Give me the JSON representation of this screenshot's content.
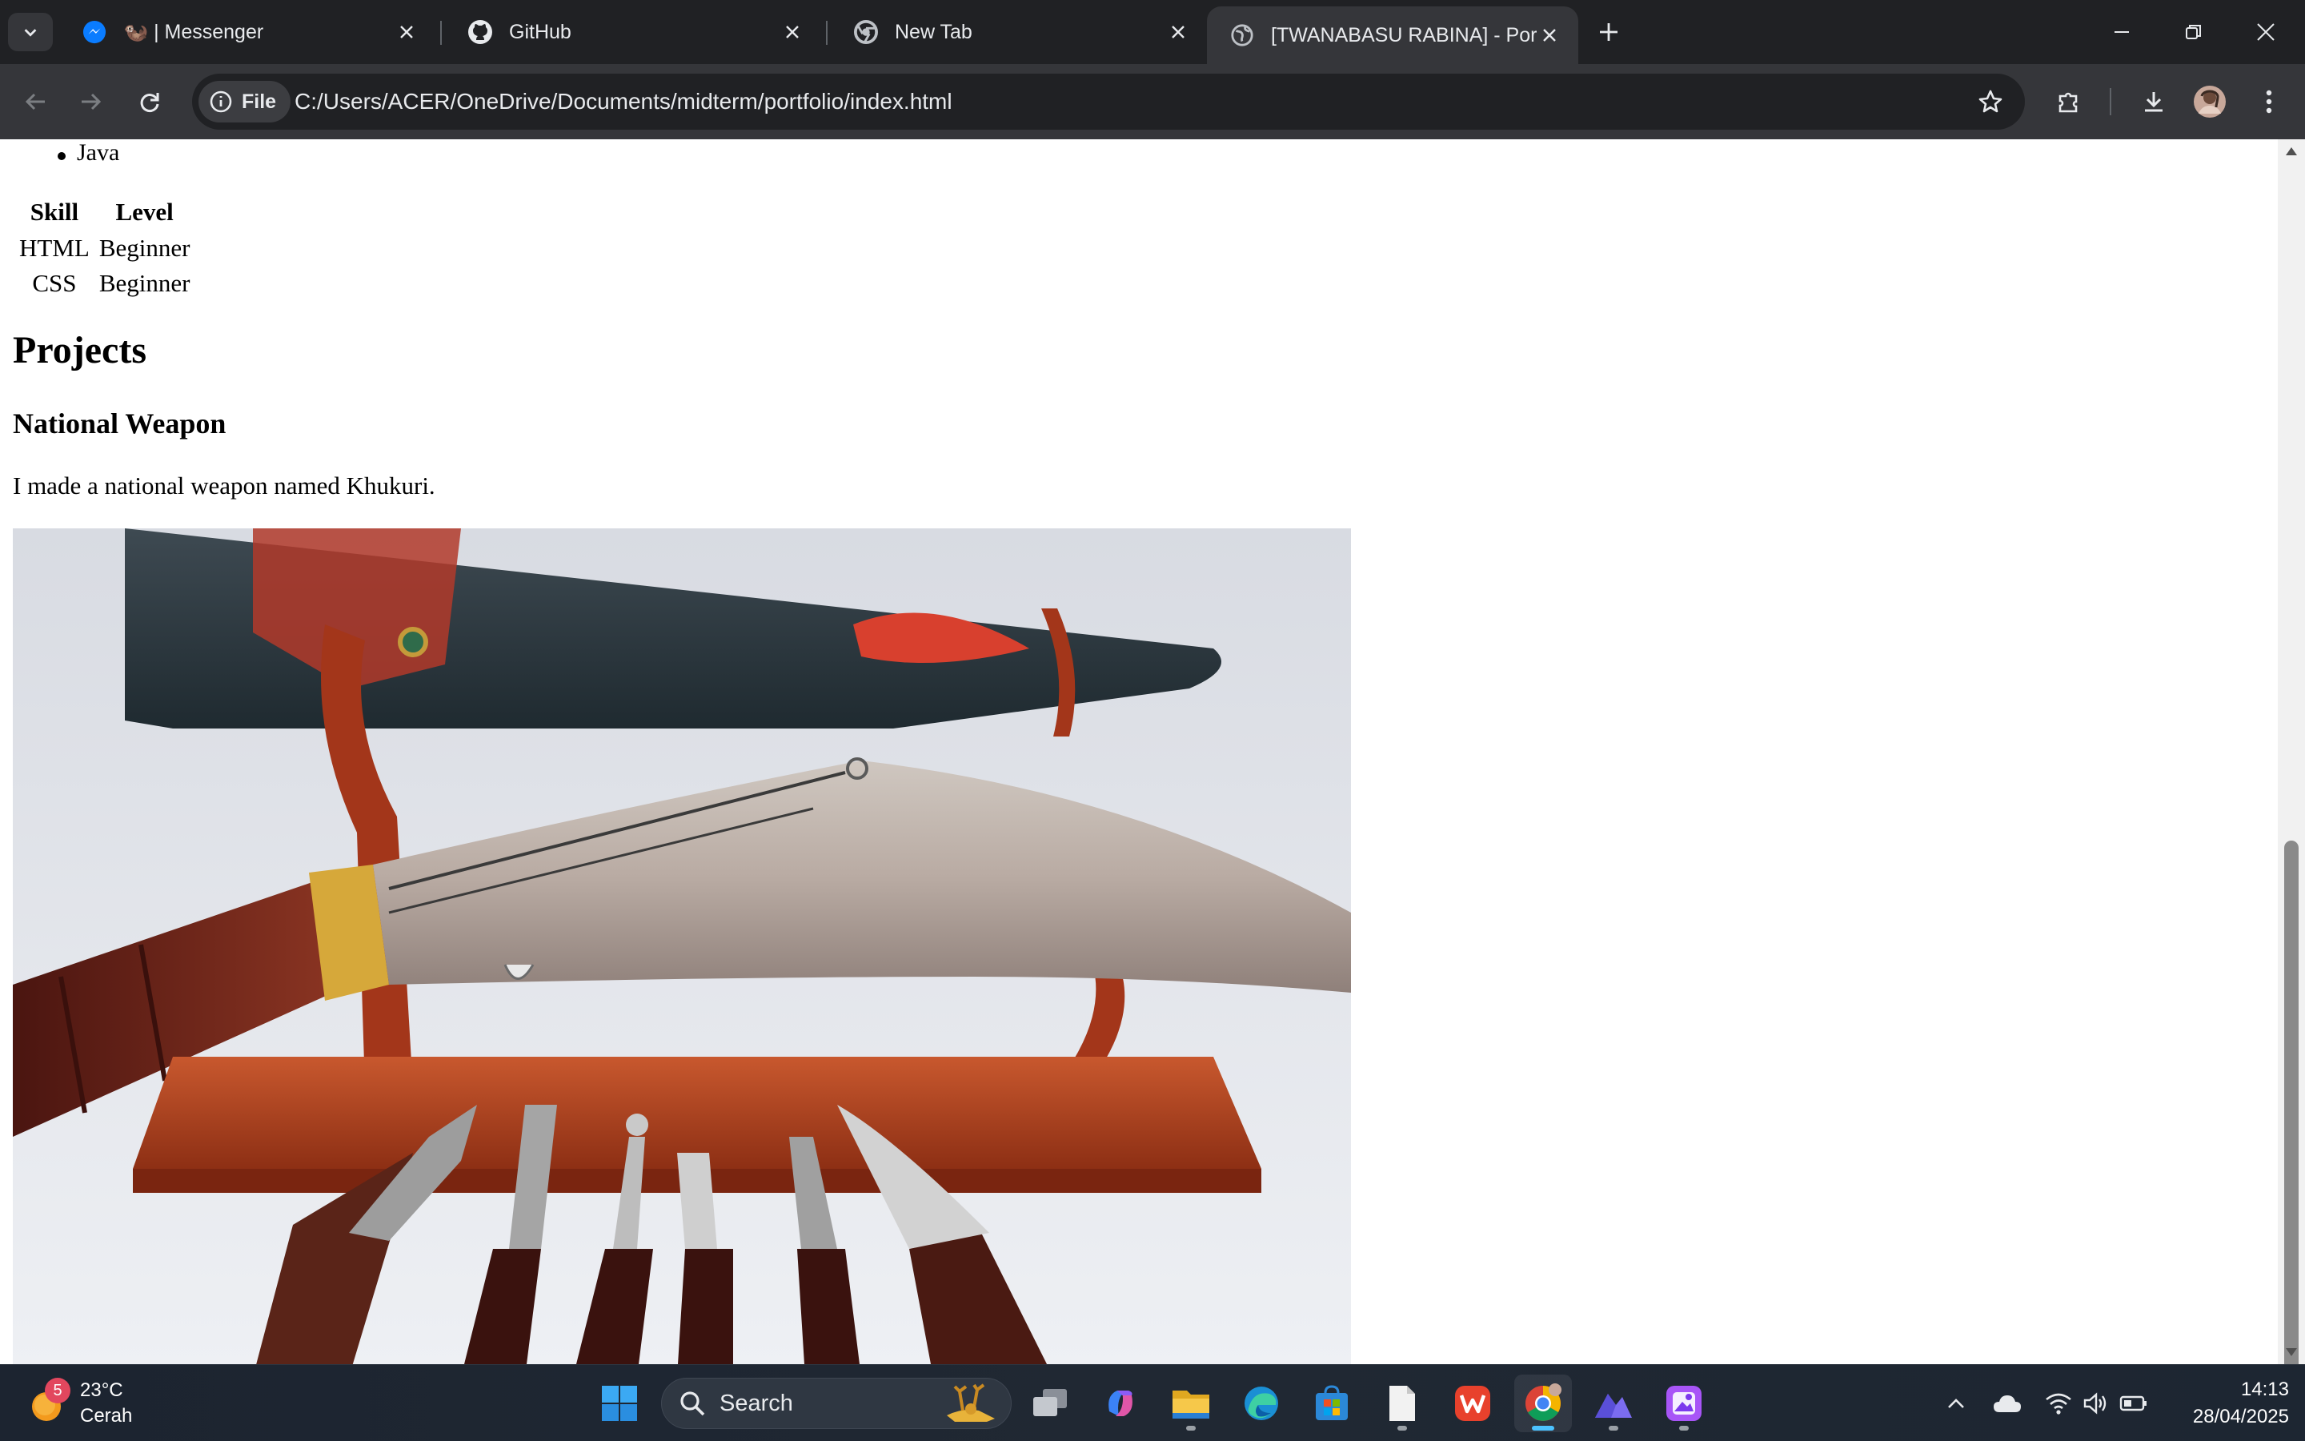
{
  "browser": {
    "tabs": [
      {
        "title": "🦦 | Messenger",
        "favicon": "messenger-icon",
        "active": false
      },
      {
        "title": "GitHub",
        "favicon": "github-icon",
        "active": false
      },
      {
        "title": "New Tab",
        "favicon": "chrome-icon",
        "active": false
      },
      {
        "title": "[TWANABASU RABINA] - Portfo",
        "favicon": "globe-icon",
        "active": true
      }
    ],
    "address_bar": {
      "chip_label": "File",
      "url": "C:/Users/ACER/OneDrive/Documents/midterm/portfolio/index.html"
    }
  },
  "page": {
    "skills_list": [
      "Java"
    ],
    "skills_table": {
      "headers": [
        "Skill",
        "Level"
      ],
      "rows": [
        [
          "HTML",
          "Beginner"
        ],
        [
          "CSS",
          "Beginner"
        ]
      ]
    },
    "projects_heading": "Projects",
    "projects": [
      {
        "title": "National Weapon",
        "description": "I made a national weapon named Khukuri."
      }
    ],
    "scroll_position_fraction": 0.74
  },
  "taskbar": {
    "weather": {
      "temperature": "23°C",
      "condition": "Cerah",
      "badge": "5"
    },
    "search_label": "Search",
    "apps": [
      "windows-start-icon",
      "task-view-icon",
      "copilot-icon",
      "file-explorer-icon",
      "edge-icon",
      "microsoft-store-icon",
      "notepad-icon",
      "wps-office-icon",
      "chrome-icon",
      "vscode-icon",
      "photos-icon"
    ],
    "clock": {
      "time": "14:13",
      "date": "28/04/2025"
    }
  },
  "colors": {
    "browser_frame": "#202124",
    "toolbar": "#35363a",
    "page_background": "#ffffff",
    "taskbar": "#1f2631",
    "active_indicator": "#4cc2ff"
  }
}
